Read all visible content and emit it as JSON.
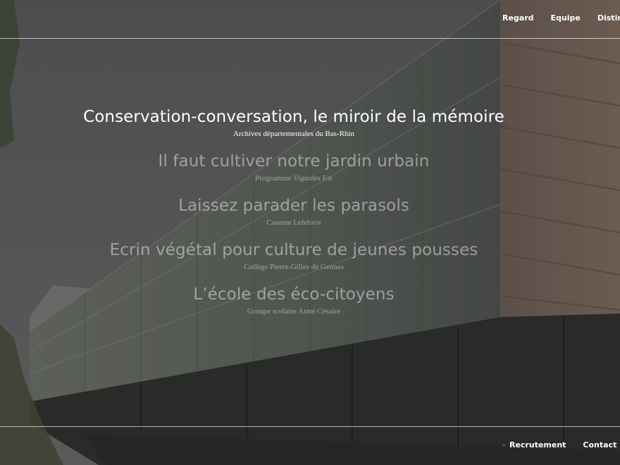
{
  "nav": {
    "top": [
      "Regard",
      "Equipe",
      "Distinctions"
    ],
    "bottom_separator": "-",
    "bottom": [
      "Recrutement",
      "Contact"
    ]
  },
  "projects": [
    {
      "title": "Conservation-conversation, le miroir de la mémoire",
      "subtitle": "Archives départementales du Bas-Rhin",
      "active": true
    },
    {
      "title": "Il faut cultiver notre jardin urbain",
      "subtitle": "Programme Vignoles Est",
      "active": false
    },
    {
      "title": "Laissez parader les parasols",
      "subtitle": "Caserne Lefebvre",
      "active": false
    },
    {
      "title": "Ecrin végétal pour culture de jeunes pousses",
      "subtitle": "Collège Pierre-Gilles de Gennes",
      "active": false
    },
    {
      "title": "L’école des éco-citoyens",
      "subtitle": "Groupe scolaire Aimé Césaire",
      "active": false
    }
  ],
  "colors": {
    "text_active": "#ffffff",
    "text_inactive": "rgba(255,255,255,0.45)",
    "overlay": "#3a3a3a"
  }
}
